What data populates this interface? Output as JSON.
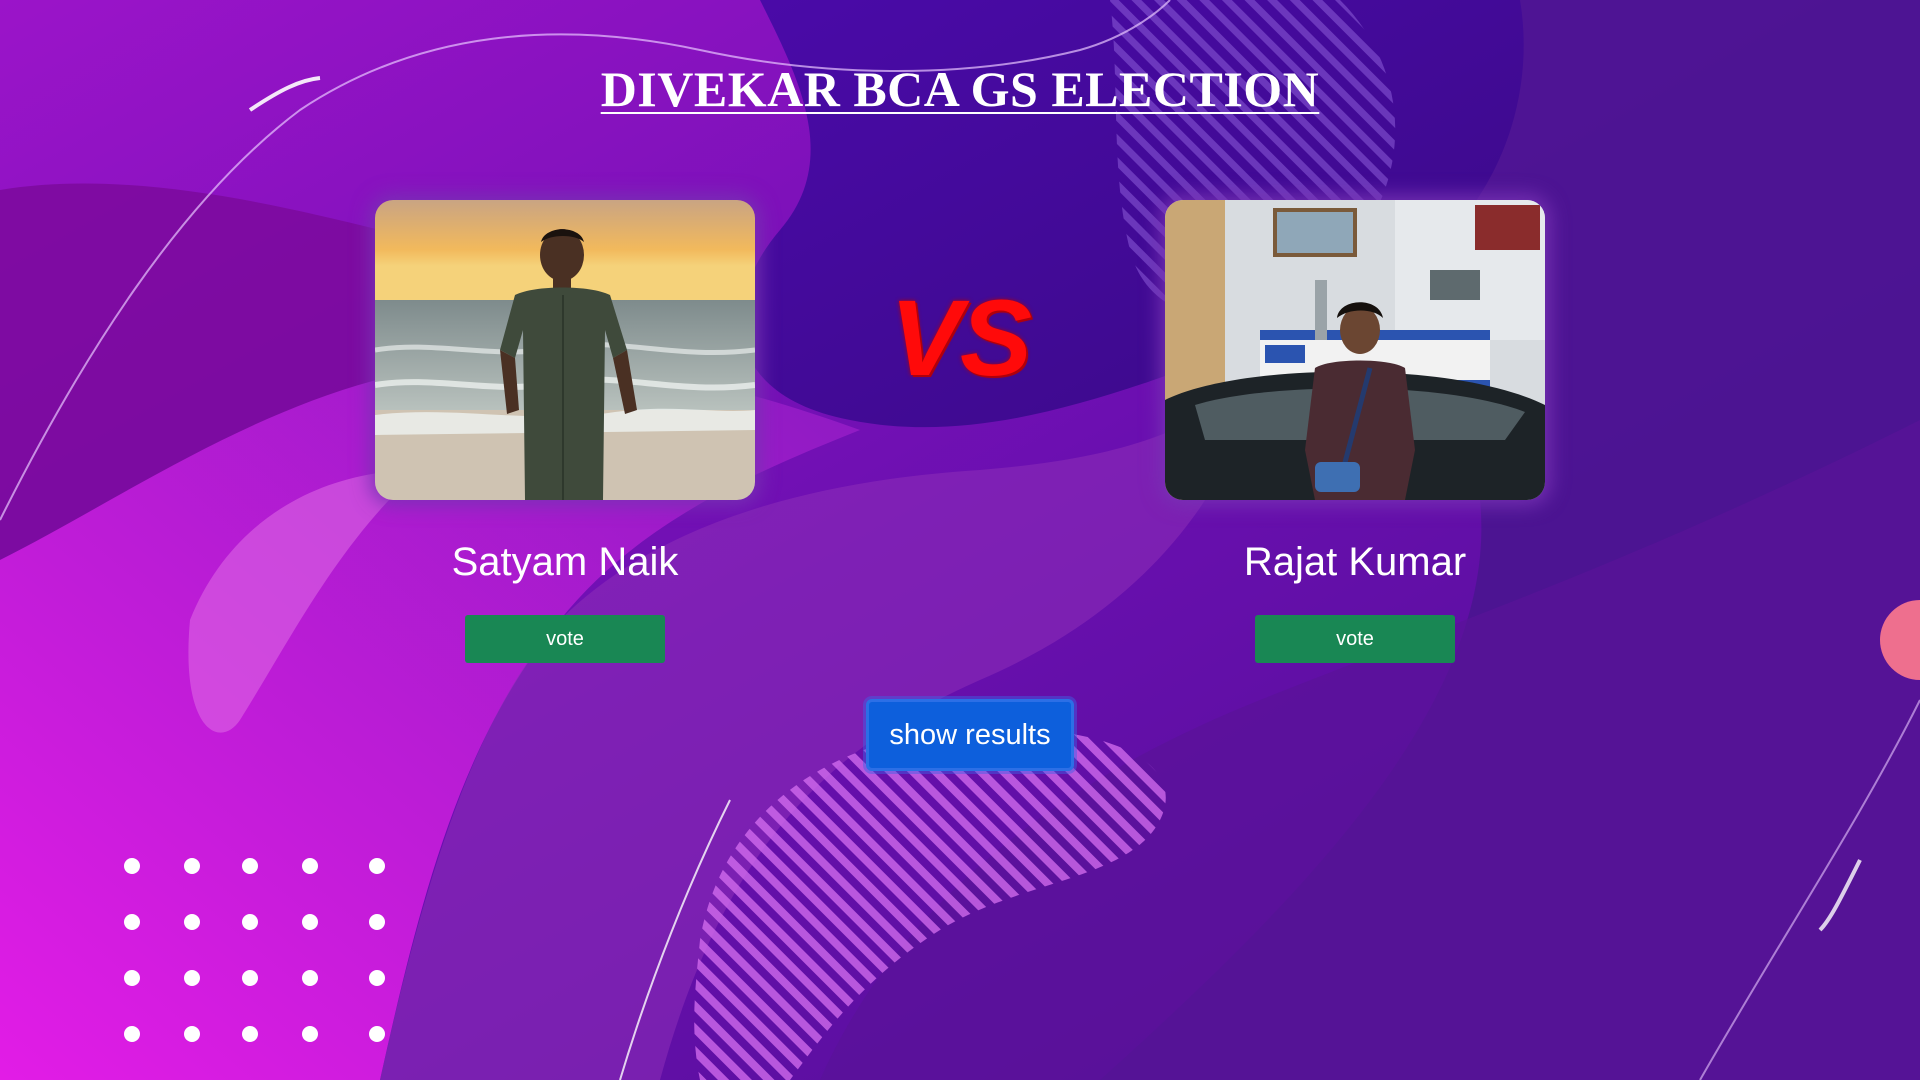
{
  "page": {
    "title": "DIVEKAR BCA GS ELECTION",
    "vs_label": "VS",
    "show_results_label": "show results"
  },
  "candidates": [
    {
      "name": "Satyam Naik",
      "vote_label": "vote"
    },
    {
      "name": "Rajat Kumar",
      "vote_label": "vote"
    }
  ],
  "colors": {
    "background": "#4d0f94",
    "vote_button": "#198754",
    "results_button": "#0d5fdc",
    "vs_text": "#ff0a0a"
  }
}
